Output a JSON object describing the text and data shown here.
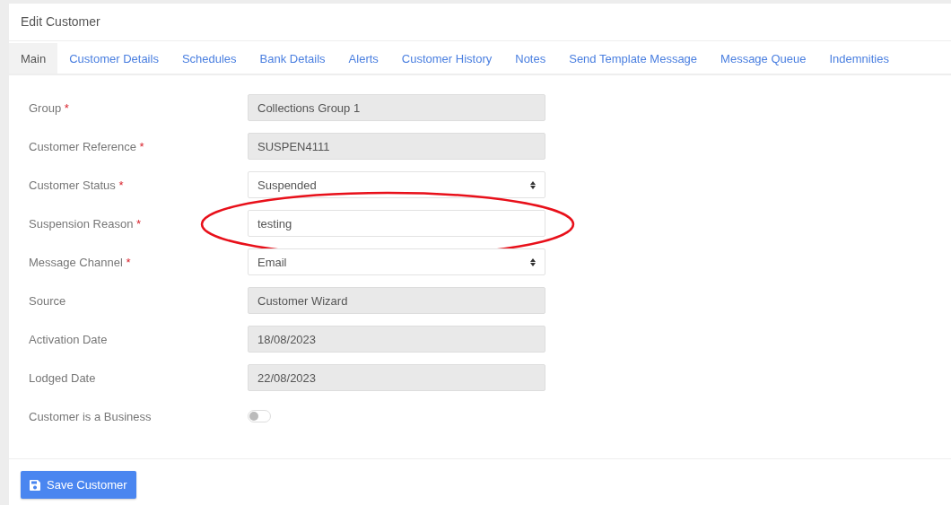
{
  "title": "Edit Customer",
  "tabs": [
    {
      "label": "Main",
      "selected": true
    },
    {
      "label": "Customer Details",
      "selected": false
    },
    {
      "label": "Schedules",
      "selected": false
    },
    {
      "label": "Bank Details",
      "selected": false
    },
    {
      "label": "Alerts",
      "selected": false
    },
    {
      "label": "Customer History",
      "selected": false
    },
    {
      "label": "Notes",
      "selected": false
    },
    {
      "label": "Send Template Message",
      "selected": false
    },
    {
      "label": "Message Queue",
      "selected": false
    },
    {
      "label": "Indemnities",
      "selected": false
    }
  ],
  "fields": [
    {
      "label": "Group",
      "required": true,
      "kind": "readonly",
      "value": "Collections Group 1",
      "highlighted": false
    },
    {
      "label": "Customer Reference",
      "required": true,
      "kind": "readonly",
      "value": "SUSPEN4111",
      "highlighted": false
    },
    {
      "label": "Customer Status",
      "required": true,
      "kind": "select",
      "value": "Suspended",
      "highlighted": false
    },
    {
      "label": "Suspension Reason",
      "required": true,
      "kind": "text",
      "value": "testing",
      "highlighted": true
    },
    {
      "label": "Message Channel",
      "required": true,
      "kind": "select",
      "value": "Email",
      "highlighted": false
    },
    {
      "label": "Source",
      "required": false,
      "kind": "readonly",
      "value": "Customer Wizard",
      "highlighted": false
    },
    {
      "label": "Activation Date",
      "required": false,
      "kind": "readonly",
      "value": "18/08/2023",
      "highlighted": false
    },
    {
      "label": "Lodged Date",
      "required": false,
      "kind": "readonly",
      "value": "22/08/2023",
      "highlighted": false
    },
    {
      "label": "Customer is a Business",
      "required": false,
      "kind": "toggle",
      "on": false,
      "highlighted": false
    }
  ],
  "save_button": "Save Customer",
  "required_mark": "*"
}
